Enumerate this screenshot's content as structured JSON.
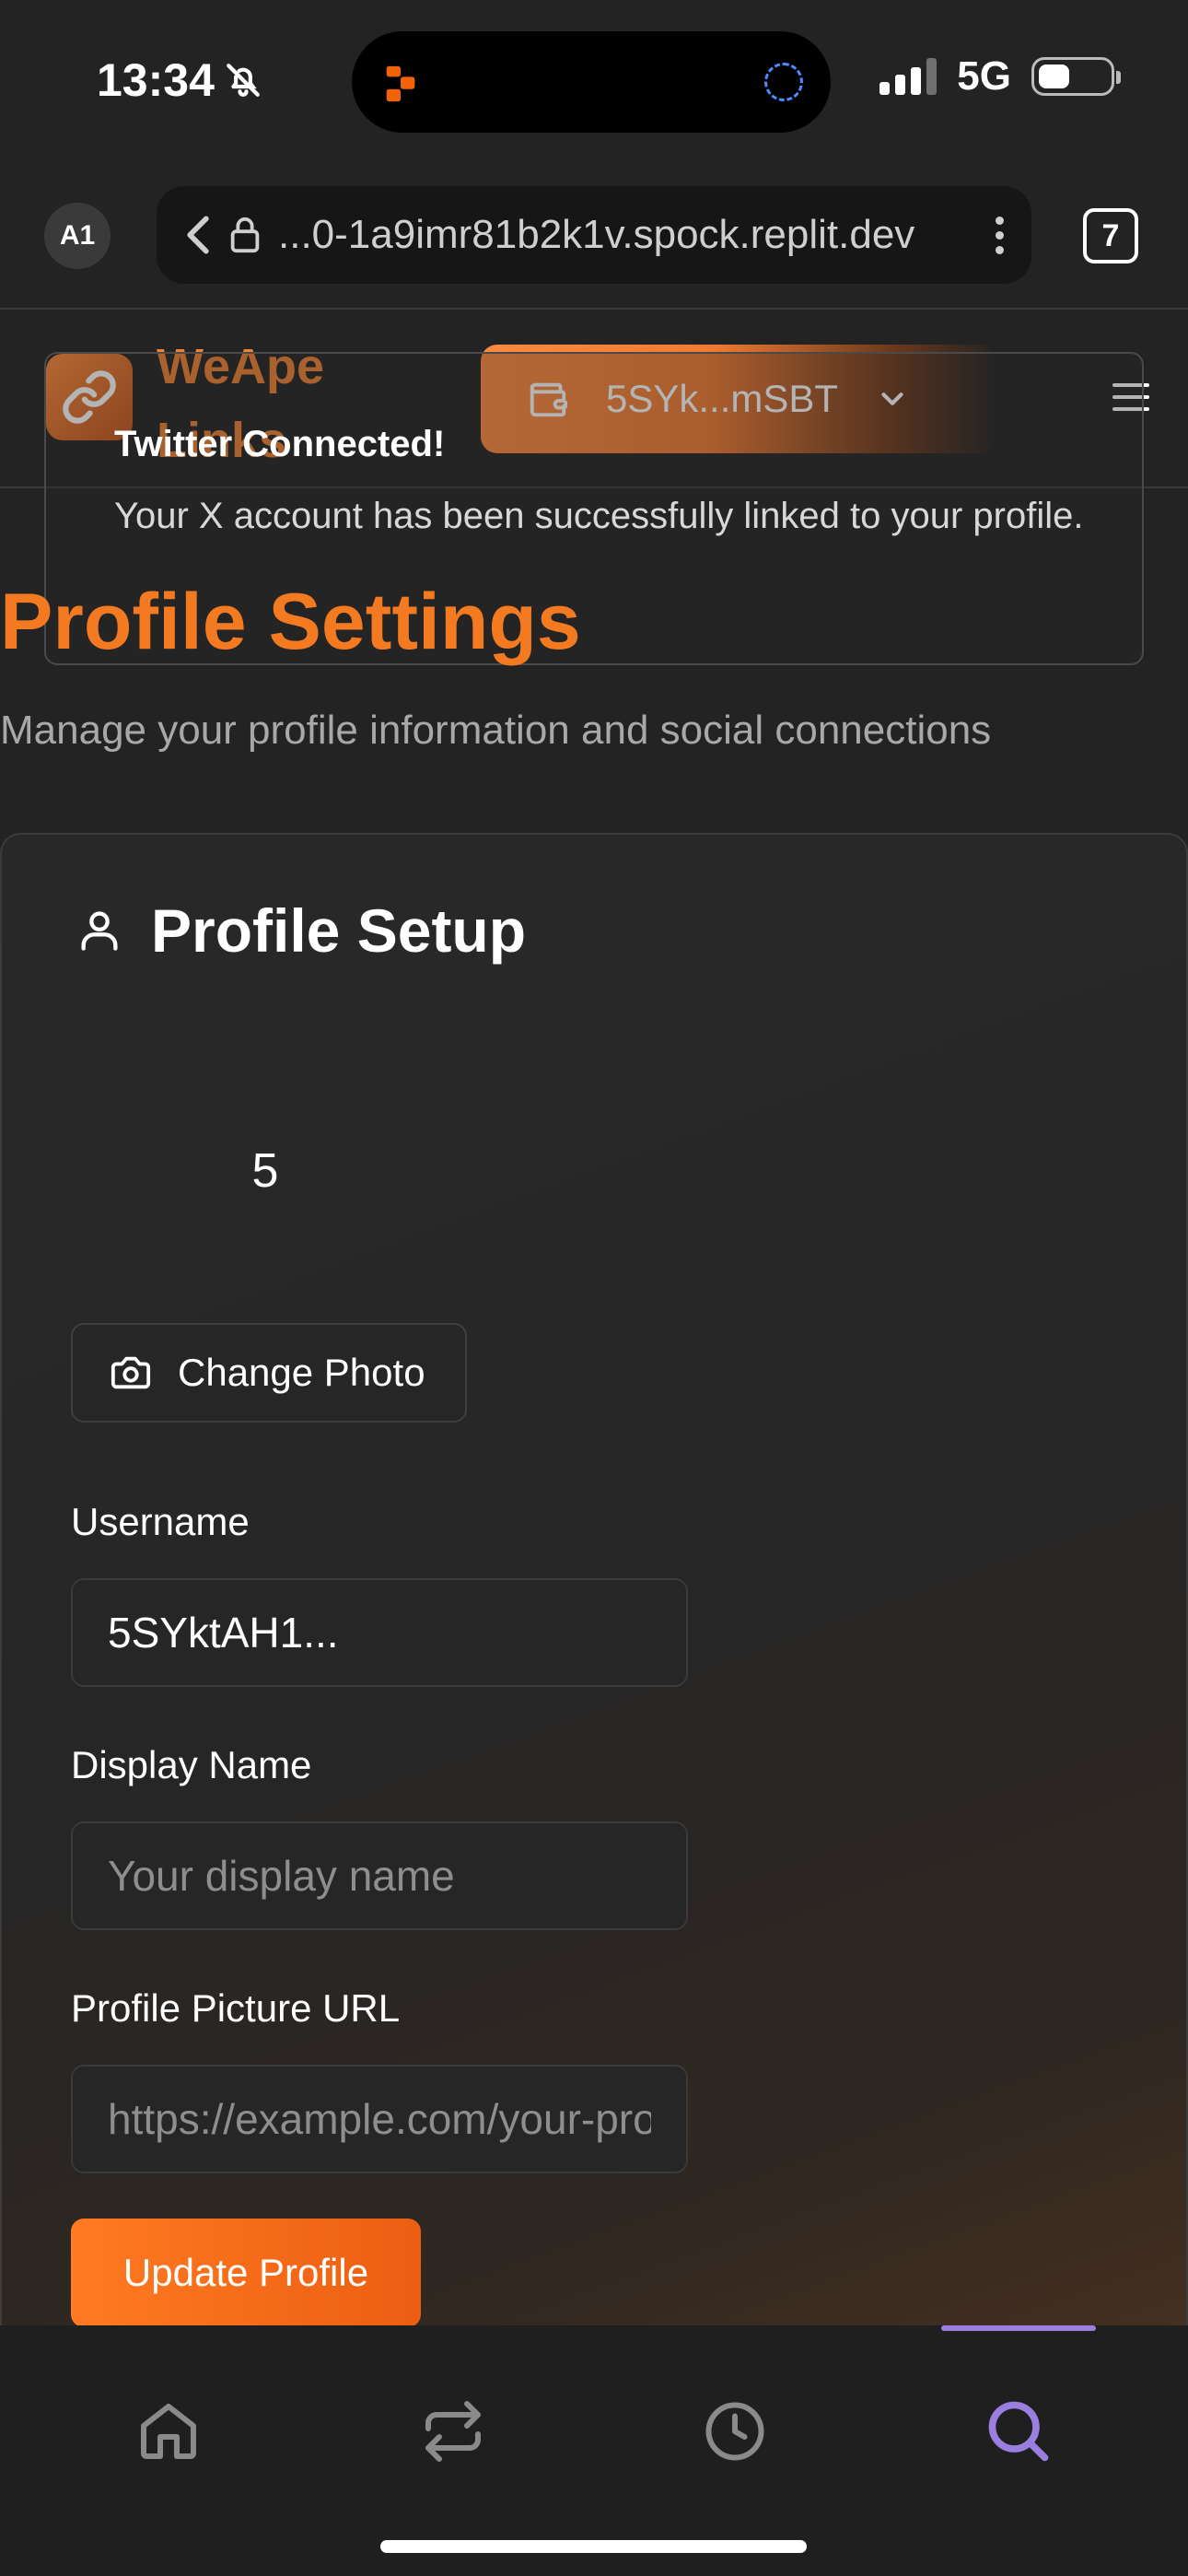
{
  "status_bar": {
    "time": "13:34",
    "network": "5G",
    "battery_level": 0.45,
    "icons": [
      "bell-slash-icon",
      "signal-icon",
      "battery-icon"
    ]
  },
  "browser": {
    "account_badge": "A1",
    "url": "...0-1a9imr81b2k1v.spock.replit.dev",
    "tab_count": "7"
  },
  "header": {
    "brand_name": "WeApe Links",
    "wallet_address": "5SYk...mSBT",
    "accent_color": "#f47a22"
  },
  "toast": {
    "title": "Twitter Connected!",
    "message": "Your X account has been successfully linked to your profile."
  },
  "page": {
    "title": "Profile Settings",
    "subtitle": "Manage your profile information and social connections"
  },
  "profile_card": {
    "title": "Profile Setup",
    "avatar_fallback": "5",
    "change_photo_label": "Change Photo",
    "username_label": "Username",
    "username_value": "5SYktAH1...",
    "display_name_label": "Display Name",
    "display_name_placeholder": "Your display name",
    "picture_url_label": "Profile Picture URL",
    "picture_url_placeholder": "https://example.com/your-profile.jpg",
    "update_button_label": "Update Profile"
  },
  "bottom_nav": {
    "items": [
      "home-icon",
      "swap-icon",
      "history-icon",
      "search-icon"
    ],
    "active": "search-icon",
    "active_color": "#9b7fe0"
  }
}
